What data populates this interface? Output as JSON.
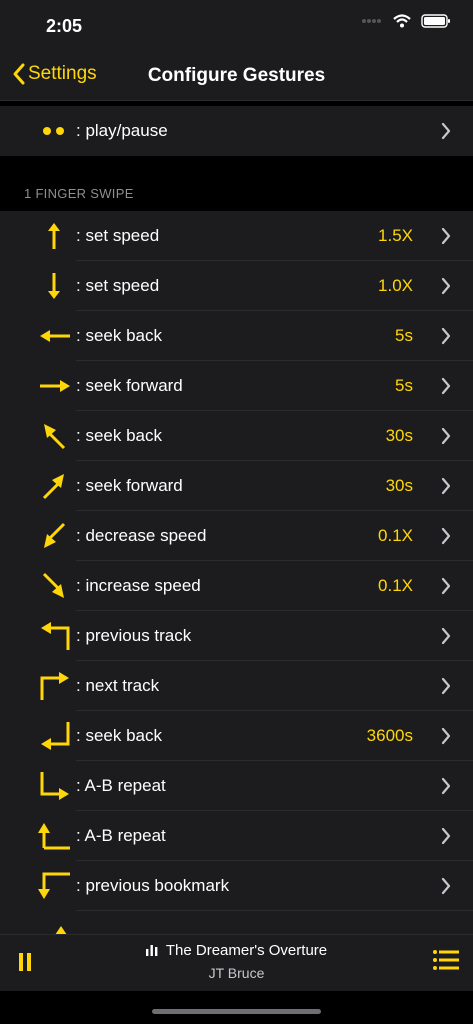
{
  "status": {
    "time": "2:05"
  },
  "nav": {
    "back_label": "Settings",
    "title": "Configure Gestures"
  },
  "top_row": {
    "icon": "two-dots-icon",
    "label": ": play/pause"
  },
  "section": {
    "header": "1 FINGER SWIPE"
  },
  "gestures": [
    {
      "icon": "arrow-up-icon",
      "label": ": set speed",
      "value": "1.5X"
    },
    {
      "icon": "arrow-down-icon",
      "label": ": set speed",
      "value": "1.0X"
    },
    {
      "icon": "arrow-left-icon",
      "label": ": seek back",
      "value": "5s"
    },
    {
      "icon": "arrow-right-icon",
      "label": ": seek forward",
      "value": "5s"
    },
    {
      "icon": "arrow-up-left-icon",
      "label": ": seek back",
      "value": "30s"
    },
    {
      "icon": "arrow-up-right-icon",
      "label": ": seek forward",
      "value": "30s"
    },
    {
      "icon": "arrow-down-left-icon",
      "label": ": decrease speed",
      "value": "0.1X"
    },
    {
      "icon": "arrow-down-right-icon",
      "label": ": increase speed",
      "value": "0.1X"
    },
    {
      "icon": "down-then-left-up-icon",
      "label": ": previous track",
      "value": ""
    },
    {
      "icon": "up-then-right-icon",
      "label": ": next track",
      "value": ""
    },
    {
      "icon": "down-then-left-icon",
      "label": ": seek back",
      "value": "3600s"
    },
    {
      "icon": "down-then-right-icon",
      "label": ": A-B repeat",
      "value": ""
    },
    {
      "icon": "up-then-right-return-icon",
      "label": ": A-B repeat",
      "value": ""
    },
    {
      "icon": "left-then-down-icon",
      "label": ": previous bookmark",
      "value": ""
    }
  ],
  "player": {
    "title": "The Dreamer's Overture",
    "artist": "JT Bruce"
  },
  "colors": {
    "accent": "#ffd60a",
    "row_bg": "#1c1c1e",
    "background": "#000000"
  }
}
